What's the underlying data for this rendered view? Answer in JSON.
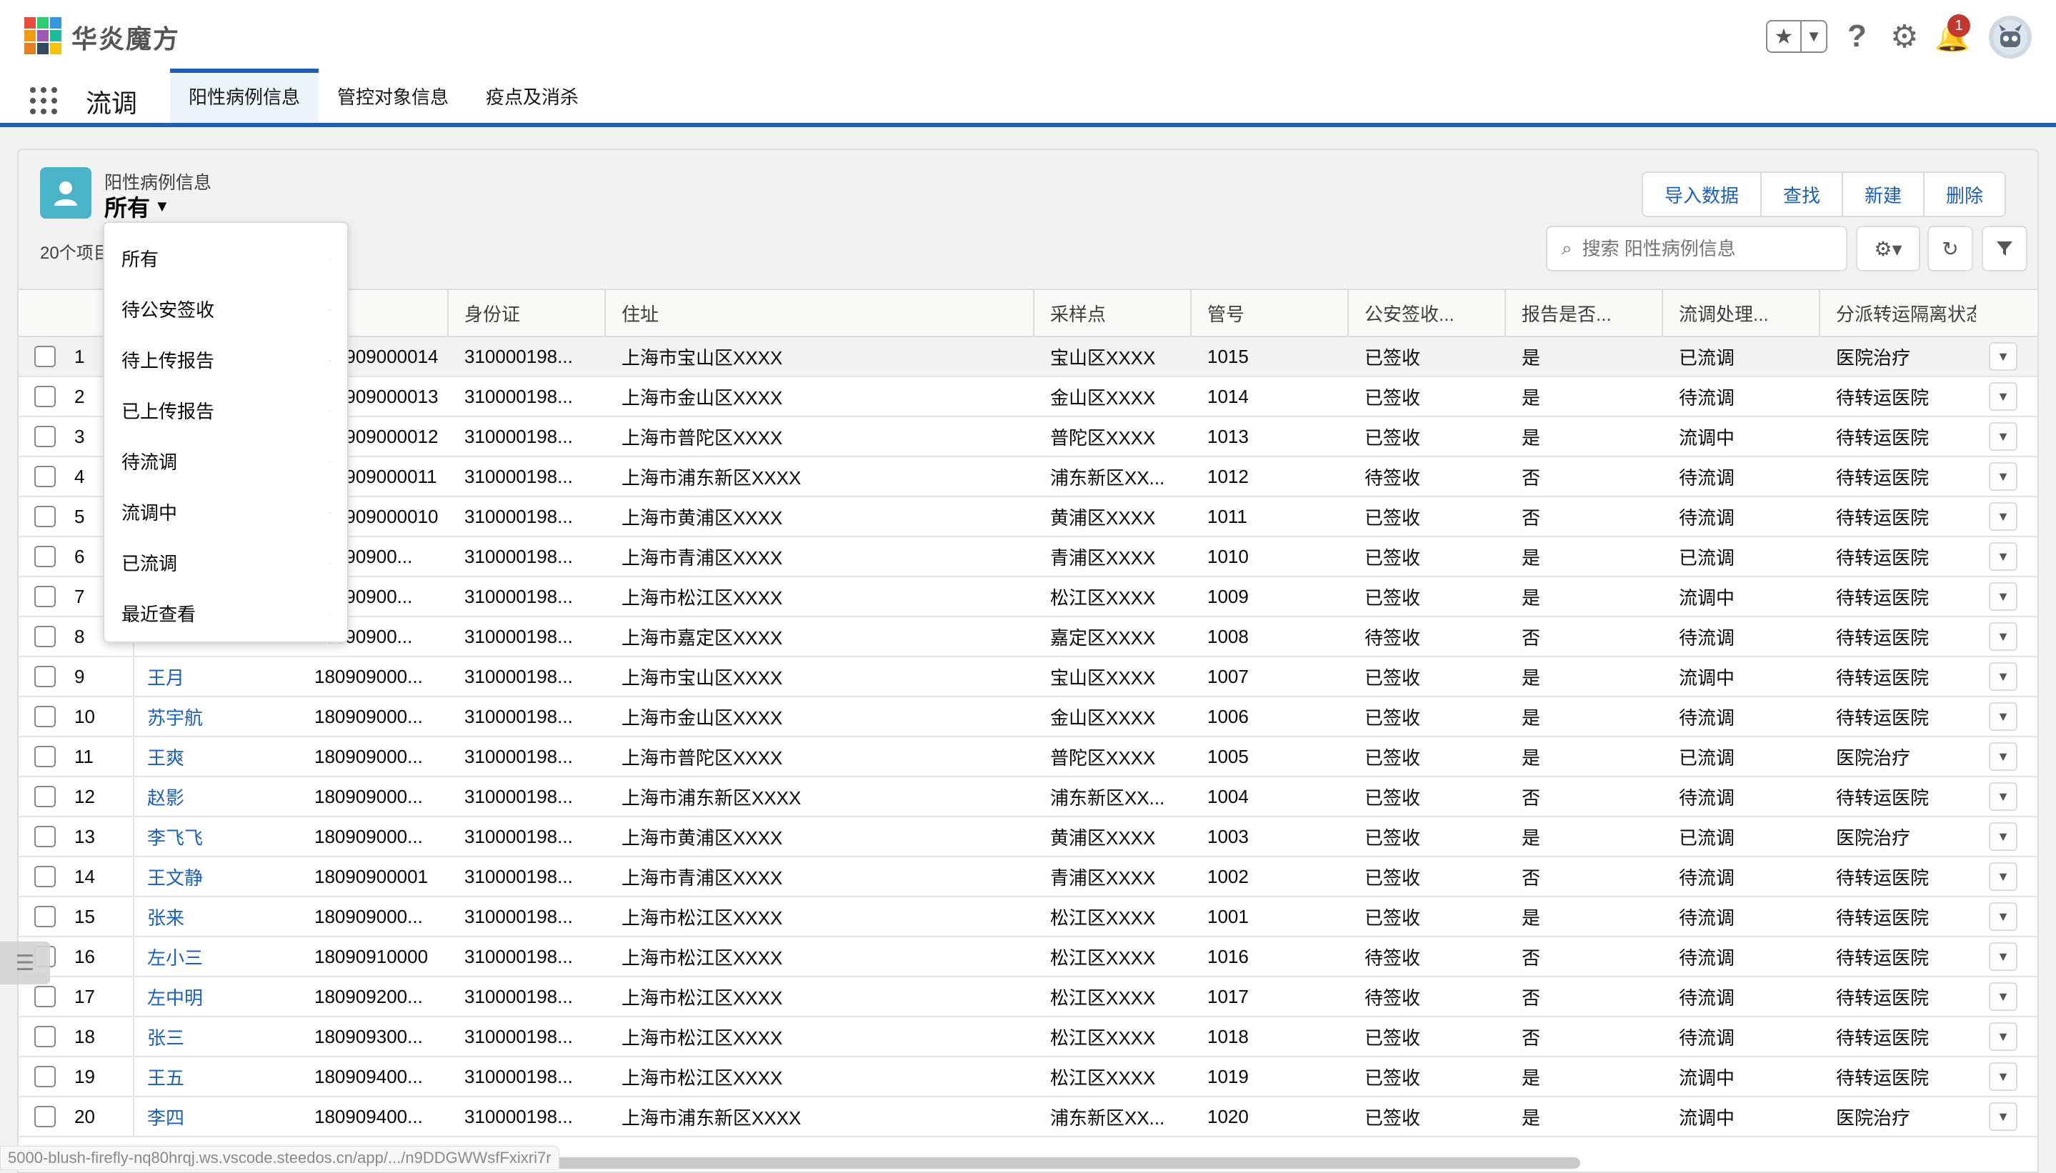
{
  "brand": {
    "name": "华炎魔方",
    "logo_colors": [
      "#e84c3d",
      "#2ecc71",
      "#3498db",
      "#f39c12",
      "#9b59b6",
      "#1abc9c",
      "#e67e22",
      "#34495e",
      "#f1c40f"
    ]
  },
  "header": {
    "favorites_icon": "star-icon",
    "help_icon": "question-icon",
    "settings_icon": "gear-icon",
    "notifications": {
      "icon": "bell-icon",
      "count": "1"
    },
    "avatar": "robot-avatar"
  },
  "nav": {
    "app_name": "流调",
    "tabs": [
      {
        "label": "阳性病例信息",
        "active": true
      },
      {
        "label": "管控对象信息",
        "active": false
      },
      {
        "label": "疫点及消杀",
        "active": false
      }
    ]
  },
  "list": {
    "object_label": "阳性病例信息",
    "current_view": "所有",
    "item_count": "20个项目",
    "buttons": [
      "导入数据",
      "查找",
      "新建",
      "删除"
    ],
    "search_placeholder": "搜索 阳性病例信息",
    "view_options": [
      "所有",
      "待公安签收",
      "待上传报告",
      "已上传报告",
      "待流调",
      "流调中",
      "已流调",
      "最近查看"
    ],
    "columns": [
      "身份证",
      "住址",
      "采样点",
      "管号",
      "公安签收...",
      "报告是否...",
      "流调处理...",
      "分派转运隔离状态"
    ],
    "rows": [
      [
        "1",
        "",
        "180909000014",
        "310000198...",
        "上海市宝山区XXXX",
        "宝山区XXXX",
        "1015",
        "已签收",
        "是",
        "已流调",
        "医院治疗"
      ],
      [
        "2",
        "",
        "180909000013",
        "310000198...",
        "上海市金山区XXXX",
        "金山区XXXX",
        "1014",
        "已签收",
        "是",
        "待流调",
        "待转运医院"
      ],
      [
        "3",
        "",
        "180909000012",
        "310000198...",
        "上海市普陀区XXXX",
        "普陀区XXXX",
        "1013",
        "已签收",
        "是",
        "流调中",
        "待转运医院"
      ],
      [
        "4",
        "",
        "180909000011",
        "310000198...",
        "上海市浦东新区XXXX",
        "浦东新区XX...",
        "1012",
        "待签收",
        "否",
        "待流调",
        "待转运医院"
      ],
      [
        "5",
        "",
        "180909000010",
        "310000198...",
        "上海市黄浦区XXXX",
        "黄浦区XXXX",
        "1011",
        "已签收",
        "否",
        "待流调",
        "待转运医院"
      ],
      [
        "6",
        "",
        "18090900...",
        "310000198...",
        "上海市青浦区XXXX",
        "青浦区XXXX",
        "1010",
        "已签收",
        "是",
        "已流调",
        "待转运医院"
      ],
      [
        "7",
        "",
        "18090900...",
        "310000198...",
        "上海市松江区XXXX",
        "松江区XXXX",
        "1009",
        "已签收",
        "是",
        "流调中",
        "待转运医院"
      ],
      [
        "8",
        "",
        "18090900...",
        "310000198...",
        "上海市嘉定区XXXX",
        "嘉定区XXXX",
        "1008",
        "待签收",
        "否",
        "待流调",
        "待转运医院"
      ],
      [
        "9",
        "王月",
        "180909000...",
        "310000198...",
        "上海市宝山区XXXX",
        "宝山区XXXX",
        "1007",
        "已签收",
        "是",
        "流调中",
        "待转运医院"
      ],
      [
        "10",
        "苏宇航",
        "180909000...",
        "310000198...",
        "上海市金山区XXXX",
        "金山区XXXX",
        "1006",
        "已签收",
        "是",
        "待流调",
        "待转运医院"
      ],
      [
        "11",
        "王爽",
        "180909000...",
        "310000198...",
        "上海市普陀区XXXX",
        "普陀区XXXX",
        "1005",
        "已签收",
        "是",
        "已流调",
        "医院治疗"
      ],
      [
        "12",
        "赵影",
        "180909000...",
        "310000198...",
        "上海市浦东新区XXXX",
        "浦东新区XX...",
        "1004",
        "已签收",
        "否",
        "待流调",
        "待转运医院"
      ],
      [
        "13",
        "李飞飞",
        "180909000...",
        "310000198...",
        "上海市黄浦区XXXX",
        "黄浦区XXXX",
        "1003",
        "已签收",
        "是",
        "已流调",
        "医院治疗"
      ],
      [
        "14",
        "王文静",
        "18090900001",
        "310000198...",
        "上海市青浦区XXXX",
        "青浦区XXXX",
        "1002",
        "已签收",
        "否",
        "待流调",
        "待转运医院"
      ],
      [
        "15",
        "张来",
        "180909000...",
        "310000198...",
        "上海市松江区XXXX",
        "松江区XXXX",
        "1001",
        "已签收",
        "是",
        "待流调",
        "待转运医院"
      ],
      [
        "16",
        "左小三",
        "18090910000",
        "310000198...",
        "上海市松江区XXXX",
        "松江区XXXX",
        "1016",
        "待签收",
        "否",
        "待流调",
        "待转运医院"
      ],
      [
        "17",
        "左中明",
        "180909200...",
        "310000198...",
        "上海市松江区XXXX",
        "松江区XXXX",
        "1017",
        "待签收",
        "否",
        "待流调",
        "待转运医院"
      ],
      [
        "18",
        "张三",
        "180909300...",
        "310000198...",
        "上海市松江区XXXX",
        "松江区XXXX",
        "1018",
        "已签收",
        "否",
        "待流调",
        "待转运医院"
      ],
      [
        "19",
        "王五",
        "180909400...",
        "310000198...",
        "上海市松江区XXXX",
        "松江区XXXX",
        "1019",
        "已签收",
        "是",
        "流调中",
        "待转运医院"
      ],
      [
        "20",
        "李四",
        "180909400...",
        "310000198...",
        "上海市浦东新区XXXX",
        "浦东新区XX...",
        "1020",
        "已签收",
        "是",
        "流调中",
        "医院治疗"
      ]
    ]
  },
  "status_bar": {
    "url": "5000-blush-firefly-nq80hrqj.ws.vscode.steedos.cn/app/.../n9DDGWWsfFxixri7r"
  },
  "colors": {
    "brand_blue": "#1b5fb6",
    "object_icon": "#4bb3c8",
    "badge_red": "#c23934"
  }
}
